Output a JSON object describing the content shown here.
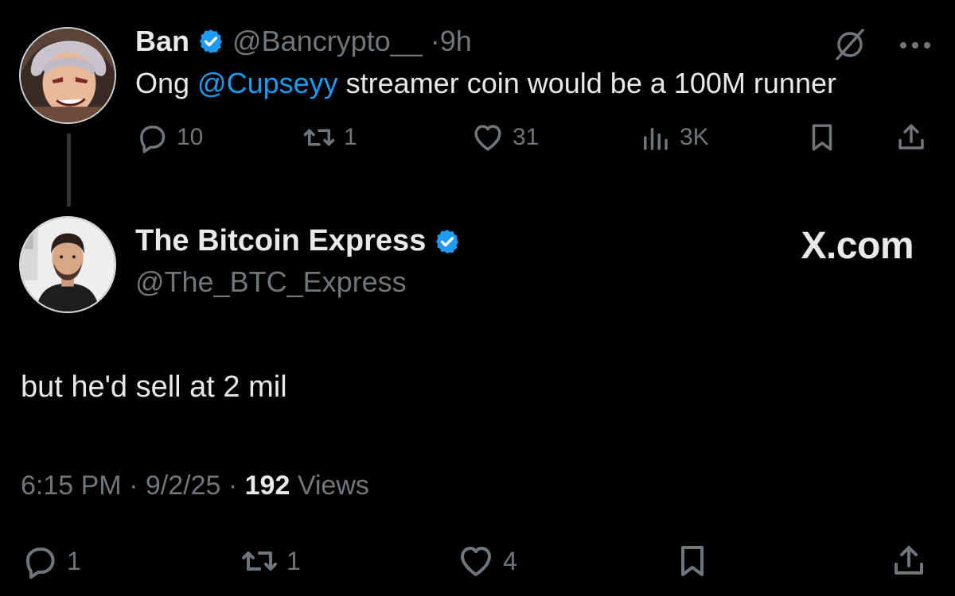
{
  "parent": {
    "name": "Ban",
    "handle": "@Bancrypto__",
    "time": "·9h",
    "text_before": "Ong ",
    "mention": "@Cupseyy",
    "text_after": " streamer coin would be a 100M runner",
    "actions": {
      "replies": "10",
      "reposts": "1",
      "likes": "31",
      "views": "3K"
    }
  },
  "reply": {
    "name": "The Bitcoin Express",
    "handle": "@The_BTC_Express",
    "watermark": "X.com",
    "text": "but he'd sell at 2 mil",
    "time": "6:15 PM",
    "date": "9/2/25",
    "views_count": "192",
    "views_label": "Views",
    "actions": {
      "replies": "1",
      "reposts": "1",
      "likes": "4"
    }
  },
  "icons": {
    "verified": "verified-badge-icon",
    "grok": "grok-icon",
    "more": "more-icon",
    "reply": "reply-icon",
    "repost": "repost-icon",
    "like": "like-icon",
    "views": "views-icon",
    "bookmark": "bookmark-icon",
    "share": "share-icon"
  },
  "colors": {
    "background": "#000000",
    "text": "#e7e9ea",
    "muted": "#71767b",
    "accent": "#1d9bf0"
  }
}
